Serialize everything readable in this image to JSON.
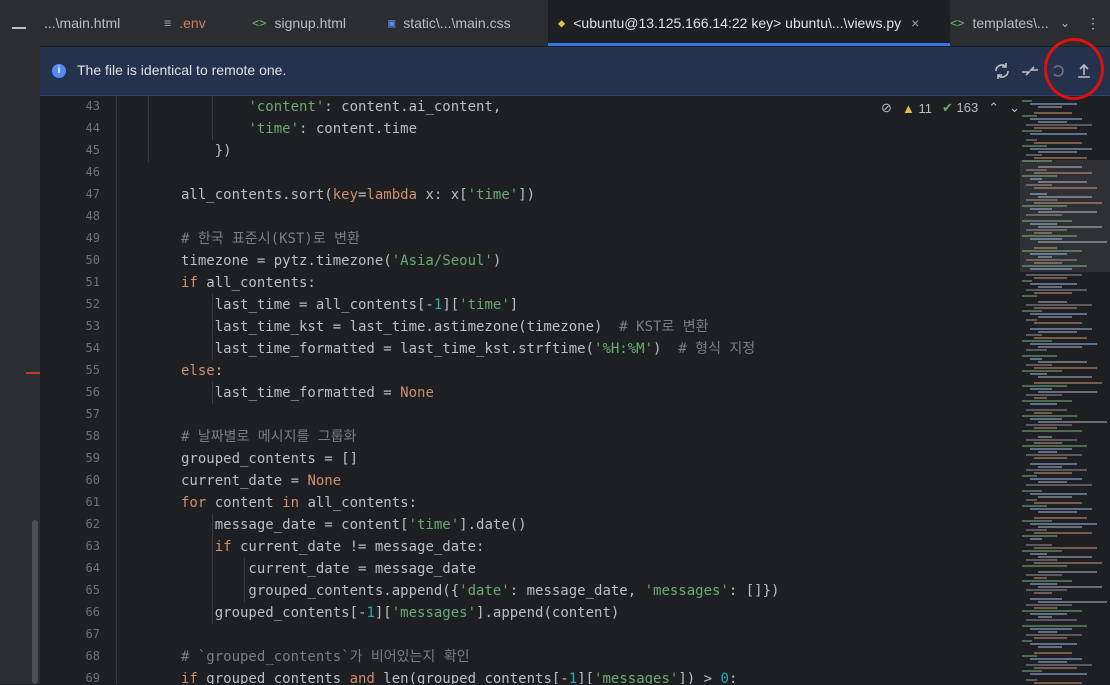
{
  "tabs": [
    {
      "label": "...\\main.html",
      "icon": "html-icon",
      "active": false
    },
    {
      "label": ".env",
      "icon": "text-file-icon",
      "active": false
    },
    {
      "label": "signup.html",
      "icon": "html-icon",
      "active": false
    },
    {
      "label": "static\\...\\main.css",
      "icon": "css-icon",
      "active": false
    },
    {
      "label": "<ubuntu@13.125.166.14:22 key> ubuntu\\...\\views.py",
      "icon": "python-icon",
      "active": true
    },
    {
      "label": "templates\\...",
      "icon": "html-icon",
      "active": false
    }
  ],
  "banner": {
    "message": "The file is identical to remote one.",
    "info_icon": "i"
  },
  "inspections": {
    "warnings": "11",
    "ok_count": "163"
  },
  "gutter": [
    "43",
    "44",
    "45",
    "46",
    "47",
    "48",
    "49",
    "50",
    "51",
    "52",
    "53",
    "54",
    "55",
    "56",
    "57",
    "58",
    "59",
    "60",
    "61",
    "62",
    "63",
    "64",
    "65",
    "66",
    "67",
    "68",
    "69"
  ],
  "code_lines": [
    "            'content': content.ai_content,",
    "            'time': content.time",
    "        })",
    "",
    "    all_contents.sort(key=lambda x: x['time'])",
    "",
    "    # 한국 표준시(KST)로 변환",
    "    timezone = pytz.timezone('Asia/Seoul')",
    "    if all_contents:",
    "        last_time = all_contents[-1]['time']",
    "        last_time_kst = last_time.astimezone(timezone)  # KST로 변환",
    "        last_time_formatted = last_time_kst.strftime('%H:%M')  # 형식 지정",
    "    else:",
    "        last_time_formatted = None",
    "",
    "    # 날짜별로 메시지를 그룹화",
    "    grouped_contents = []",
    "    current_date = None",
    "    for content in all_contents:",
    "        message_date = content['time'].date()",
    "        if current_date != message_date:",
    "            current_date = message_date",
    "            grouped_contents.append({'date': message_date, 'messages': []})",
    "        grouped_contents[-1]['messages'].append(content)",
    "",
    "    # `grouped_contents`가 비어있는지 확인",
    "    if grouped_contents and len(grouped_contents[-1]['messages']) > 0:"
  ],
  "colors": {
    "keyword": "#cf8e6d",
    "string": "#6aab73",
    "number": "#2aacb8",
    "comment": "#7a7e85",
    "accent": "#3574f0",
    "annotation_red": "#e01010"
  }
}
